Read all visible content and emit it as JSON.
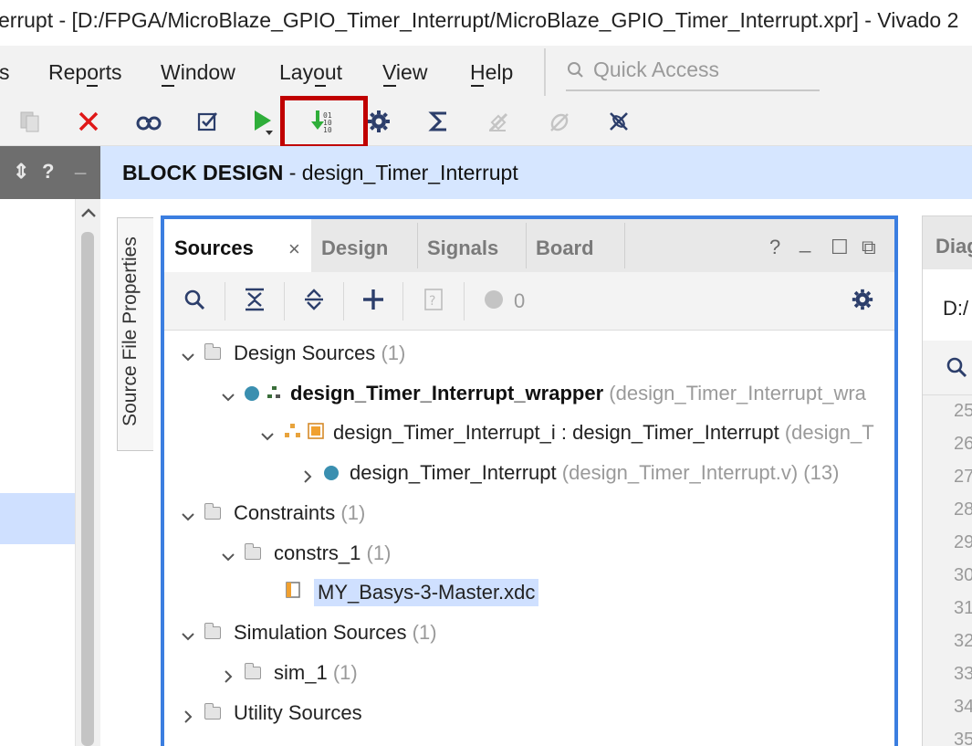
{
  "window": {
    "title": "errupt - [D:/FPGA/MicroBlaze_GPIO_Timer_Interrupt/MicroBlaze_GPIO_Timer_Interrupt.xpr] - Vivado 2"
  },
  "menubar": {
    "items": [
      {
        "id": "tools",
        "label": "s"
      },
      {
        "id": "reports",
        "label": "Reports"
      },
      {
        "id": "window",
        "label": "Window"
      },
      {
        "id": "layout",
        "label": "Layout"
      },
      {
        "id": "view",
        "label": "View"
      },
      {
        "id": "help",
        "label": "Help"
      }
    ],
    "quick_access": {
      "placeholder": "Quick Access",
      "icon": "search-icon"
    }
  },
  "toolbar": {
    "buttons": [
      {
        "id": "copy",
        "icon": "copy-icon",
        "enabled": false
      },
      {
        "id": "delete",
        "icon": "close-icon",
        "enabled": true
      },
      {
        "id": "find",
        "icon": "binoculars-icon",
        "enabled": true
      },
      {
        "id": "validate",
        "icon": "checkbox-icon",
        "enabled": true
      },
      {
        "id": "run",
        "icon": "play-icon",
        "enabled": true
      },
      {
        "id": "generate-bitstream",
        "icon": "bitstream-icon",
        "enabled": true,
        "highlighted": true
      },
      {
        "id": "settings",
        "icon": "gear-icon",
        "enabled": true
      },
      {
        "id": "report",
        "icon": "sigma-icon",
        "enabled": true
      },
      {
        "id": "debug1",
        "icon": "debug-icon",
        "enabled": false
      },
      {
        "id": "debug2",
        "icon": "debug-icon",
        "enabled": false
      },
      {
        "id": "debug3",
        "icon": "debug-icon",
        "enabled": true
      }
    ],
    "highlight_color": "#c00000"
  },
  "left_panel": {
    "controls": [
      "⇕",
      "?",
      "_"
    ]
  },
  "block_design": {
    "title_bold": "BLOCK DESIGN",
    "title_rest": " - design_Timer_Interrupt"
  },
  "vertical_tab": {
    "label": "Source File Properties"
  },
  "sources_panel": {
    "tabs": [
      {
        "label": "Sources",
        "active": true
      },
      {
        "label": "Design",
        "active": false
      },
      {
        "label": "Signals",
        "active": false
      },
      {
        "label": "Board",
        "active": false
      }
    ],
    "close_glyph": "×",
    "window_controls": [
      "?",
      "_",
      "☐",
      "⧉"
    ],
    "toolbar": {
      "count": "0"
    },
    "tree": {
      "design_sources": {
        "label": "Design Sources",
        "count": "(1)"
      },
      "wrapper": {
        "label": "design_Timer_Interrupt_wrapper",
        "detail": "(design_Timer_Interrupt_wra"
      },
      "instance": {
        "label": "design_Timer_Interrupt_i : design_Timer_Interrupt",
        "detail": "(design_T"
      },
      "verilog": {
        "label": "design_Timer_Interrupt",
        "detail": "(design_Timer_Interrupt.v)",
        "count": "(13)"
      },
      "constraints": {
        "label": "Constraints",
        "count": "(1)"
      },
      "constrs_1": {
        "label": "constrs_1",
        "count": "(1)"
      },
      "xdc": {
        "label": "MY_Basys-3-Master.xdc",
        "selected": true
      },
      "simulation": {
        "label": "Simulation Sources",
        "count": "(1)"
      },
      "sim_1": {
        "label": "sim_1",
        "count": "(1)"
      },
      "utility": {
        "label": "Utility Sources"
      }
    }
  },
  "right_panel": {
    "tab_label": "Diag",
    "path": "D:/",
    "line_numbers": [
      "25",
      "26",
      "27",
      "28",
      "29",
      "30",
      "31",
      "32",
      "33",
      "34",
      "35"
    ]
  },
  "colors": {
    "accent": "#3b7ee0",
    "selection": "#cfe0ff",
    "header": "#d6e6ff",
    "dot": "#3a8fb0"
  }
}
